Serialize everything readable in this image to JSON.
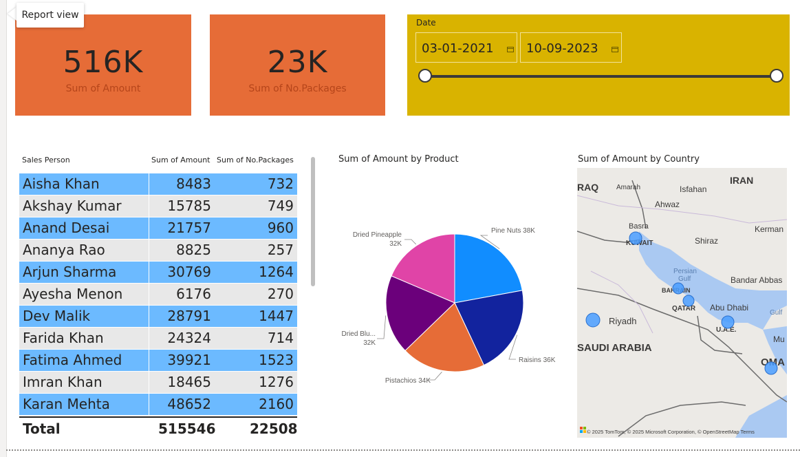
{
  "tooltip": "Report view",
  "cards": [
    {
      "value": "516K",
      "label": "Sum of Amount"
    },
    {
      "value": "23K",
      "label": "Sum of No.Packages"
    }
  ],
  "slicer": {
    "title": "Date",
    "start": "03-01-2021",
    "end": "10-09-2023"
  },
  "table": {
    "headers": [
      "Sales Person",
      "Sum of Amount",
      "Sum of No.Packages"
    ],
    "rows": [
      {
        "name": "Aisha Khan",
        "amount": "8483",
        "packages": "732"
      },
      {
        "name": "Akshay Kumar",
        "amount": "15785",
        "packages": "749"
      },
      {
        "name": "Anand Desai",
        "amount": "21757",
        "packages": "960"
      },
      {
        "name": "Ananya Rao",
        "amount": "8825",
        "packages": "257"
      },
      {
        "name": "Arjun Sharma",
        "amount": "30769",
        "packages": "1264"
      },
      {
        "name": "Ayesha Menon",
        "amount": "6176",
        "packages": "270"
      },
      {
        "name": "Dev Malik",
        "amount": "28791",
        "packages": "1447"
      },
      {
        "name": "Farida Khan",
        "amount": "24324",
        "packages": "714"
      },
      {
        "name": "Fatima Ahmed",
        "amount": "39921",
        "packages": "1523"
      },
      {
        "name": "Imran Khan",
        "amount": "18465",
        "packages": "1276"
      },
      {
        "name": "Karan Mehta",
        "amount": "48652",
        "packages": "2160"
      }
    ],
    "total": {
      "label": "Total",
      "amount": "515546",
      "packages": "22508"
    }
  },
  "colors": {
    "card": "#e66c37",
    "slicer": "#d9b300",
    "row_highlight": "#6cbaff",
    "row_plain": "#e8e8e8"
  },
  "chart_data": {
    "type": "pie",
    "title": "Sum of Amount by Product",
    "slices": [
      {
        "label": "Pine Nuts",
        "value": 38,
        "value_label": "38K",
        "color": "#118dff"
      },
      {
        "label": "Raisins",
        "value": 36,
        "value_label": "36K",
        "color": "#12239e"
      },
      {
        "label": "Pistachios",
        "value": 34,
        "value_label": "34K",
        "color": "#e66c37"
      },
      {
        "label": "Dried Blu...",
        "value": 32,
        "value_label": "32K",
        "color": "#6b007b"
      },
      {
        "label": "Dried Pineapple",
        "value": 32,
        "value_label": "32K",
        "color": "#e044a7"
      }
    ]
  },
  "map": {
    "title": "Sum of Amount by Country",
    "labels": [
      "RAQ",
      "IRAN",
      "Amarah",
      "Isfahan",
      "Ahwaz",
      "Basra",
      "KUWAIT",
      "Shiraz",
      "Kerman",
      "Persian",
      "Gulf",
      "BAHRAIN",
      "Bandar Abbas",
      "QATAR",
      "Abu Dhabi",
      "Gulf",
      "Riyadh",
      "U.A.E.",
      "SAUDI ARABIA",
      "Mu",
      "OMA"
    ],
    "attribution": "© 2025 TomTom, © 2025 Microsoft Corporation, © OpenStreetMap  Terms"
  }
}
